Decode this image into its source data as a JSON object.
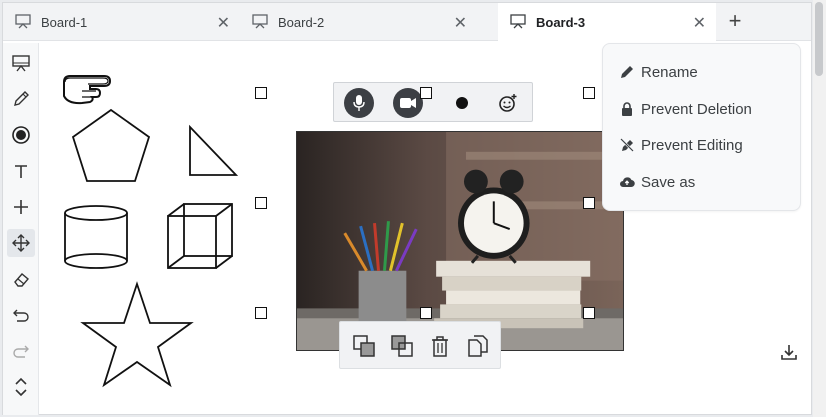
{
  "tabs": [
    {
      "label": "Board-1",
      "close": "✕",
      "active": false
    },
    {
      "label": "Board-2",
      "close": "✕",
      "active": false
    },
    {
      "label": "Board-3",
      "close": "✕",
      "active": true
    }
  ],
  "add_tab": "+",
  "toolbar": {
    "tools": [
      "board-icon",
      "pencil-icon",
      "record-icon",
      "text-icon",
      "plus-icon",
      "move-icon",
      "eraser-icon",
      "undo-icon",
      "redo-icon",
      "expand-icon"
    ],
    "active_tool": "move-icon"
  },
  "media_bar": {
    "buttons": [
      "microphone-icon",
      "video-camera-icon",
      "dot-icon",
      "emoji-icon"
    ]
  },
  "object_bar": {
    "buttons": [
      "bring-forward-icon",
      "send-backward-icon",
      "delete-icon",
      "duplicate-icon"
    ]
  },
  "context_menu": {
    "items": [
      {
        "label": "Rename",
        "icon": "pencil-icon"
      },
      {
        "label": "Prevent Deletion",
        "icon": "lock-icon"
      },
      {
        "label": "Prevent Editing",
        "icon": "no-edit-icon"
      },
      {
        "label": "Save as",
        "icon": "cloud-upload-icon"
      }
    ]
  },
  "canvas_shapes": [
    "pointing-hand",
    "pentagon",
    "right-triangle",
    "cylinder",
    "cube",
    "star"
  ],
  "colors": {
    "tab_bar": "#f2f3f5",
    "toolbar": "#f7f8f9",
    "menu": "#f8f9fa",
    "accent_dark": "#3c3f44"
  }
}
